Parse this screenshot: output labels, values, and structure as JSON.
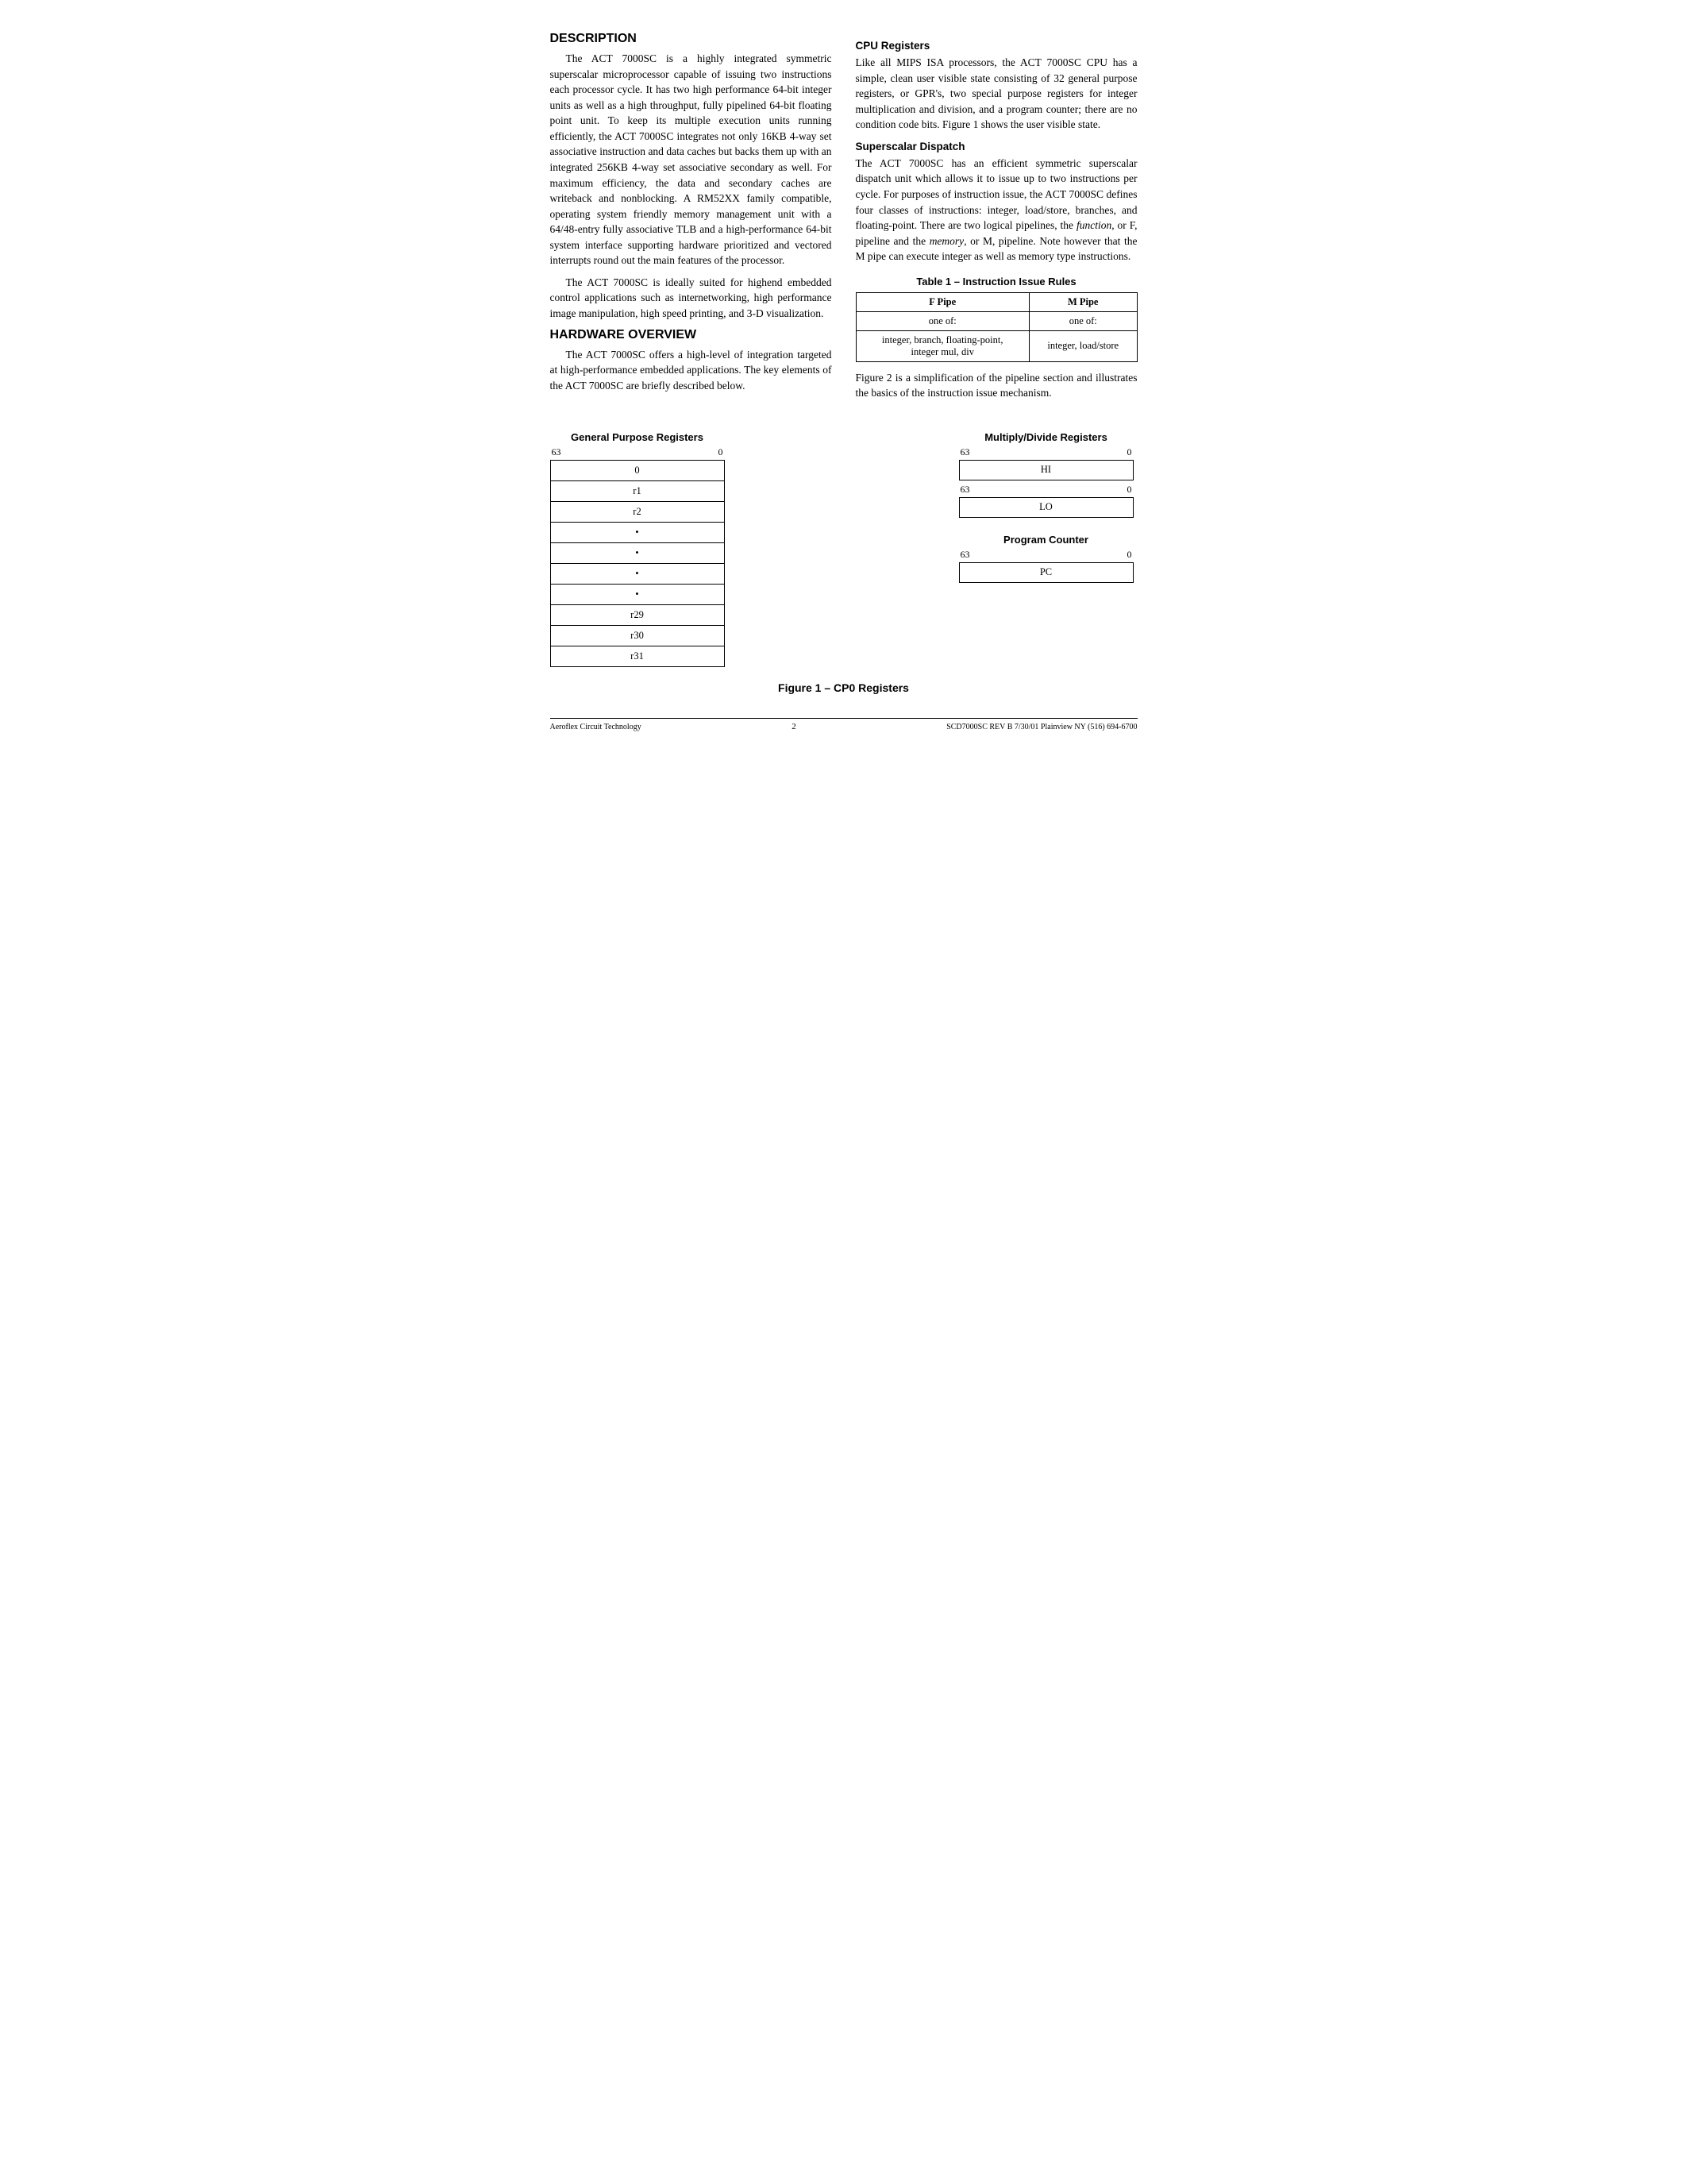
{
  "page": {
    "sections": {
      "description": {
        "title": "DESCRIPTION",
        "paragraphs": [
          "The ACT 7000SC is a highly integrated symmetric superscalar microprocessor capable of issuing two instructions each processor cycle. It has two high performance 64-bit integer units as well as a high throughput, fully pipelined 64-bit floating point unit. To keep its multiple execution units running efficiently, the ACT 7000SC integrates not only 16KB 4-way set associative instruction and data caches but backs them up with an integrated 256KB 4-way set associative secondary as well. For maximum efficiency, the data and secondary caches are writeback and nonblocking. A RM52XX family compatible, operating system friendly memory management unit with a 64/48-entry fully associative TLB and a high-performance 64-bit system interface supporting hardware prioritized and vectored interrupts round out the main features of the processor.",
          "The ACT 7000SC is ideally suited for highend embedded control applications such as internetworking, high performance image manipulation, high speed printing, and 3-D visualization."
        ]
      },
      "hardware_overview": {
        "title": "HARDWARE OVERVIEW",
        "paragraphs": [
          "The ACT 7000SC offers a high-level of integration targeted at high-performance embedded applications. The key elements of the ACT 7000SC are briefly described below."
        ]
      },
      "cpu_registers": {
        "title": "CPU Registers",
        "paragraphs": [
          "Like all MIPS ISA processors, the ACT 7000SC CPU has a simple, clean user visible state consisting of 32 general purpose registers, or GPR's, two special purpose registers for integer multiplication and division, and a program counter; there are no condition code bits. Figure 1 shows the user visible state."
        ]
      },
      "superscalar_dispatch": {
        "title": "Superscalar Dispatch",
        "paragraphs": [
          "The ACT 7000SC has an efficient symmetric superscalar dispatch unit which allows it to issue up to two instructions per cycle. For purposes of instruction issue, the ACT 7000SC defines four classes of instructions: integer, load/store, branches, and floating-point. There are two logical pipelines, the function, or F, pipeline and the memory, or M, pipeline. Note however that the M pipe can execute integer as well as memory type instructions.",
          "Figure 2 is a simplification of the pipeline section and illustrates the basics of the instruction issue mechanism."
        ]
      }
    },
    "table": {
      "title": "Table 1 – Instruction Issue Rules",
      "headers": [
        "F Pipe",
        "M Pipe"
      ],
      "subheaders": [
        "one of:",
        "one of:"
      ],
      "rows": [
        [
          "integer, branch, floating-point, integer mul, div",
          "integer, load/store"
        ]
      ]
    },
    "figure": {
      "caption": "Figure 1 – CP0 Registers",
      "gpr": {
        "title": "General Purpose Registers",
        "scale_left": "63",
        "scale_right": "0",
        "rows": [
          "0",
          "r1",
          "r2",
          "•",
          "•",
          "•",
          "•",
          "r29",
          "r30",
          "r31"
        ]
      },
      "multiply_divide": {
        "title": "Multiply/Divide Registers",
        "scale_left": "63",
        "scale_right": "0",
        "hi_label": "HI",
        "scale2_left": "63",
        "scale2_right": "0",
        "lo_label": "LO"
      },
      "program_counter": {
        "title": "Program Counter",
        "scale_left": "63",
        "scale_right": "0",
        "pc_label": "PC"
      }
    },
    "footer": {
      "left": "Aeroflex Circuit Technology",
      "center": "2",
      "right": "SCD7000SC REV B  7/30/01 Plainview NY (516) 694-6700"
    }
  }
}
